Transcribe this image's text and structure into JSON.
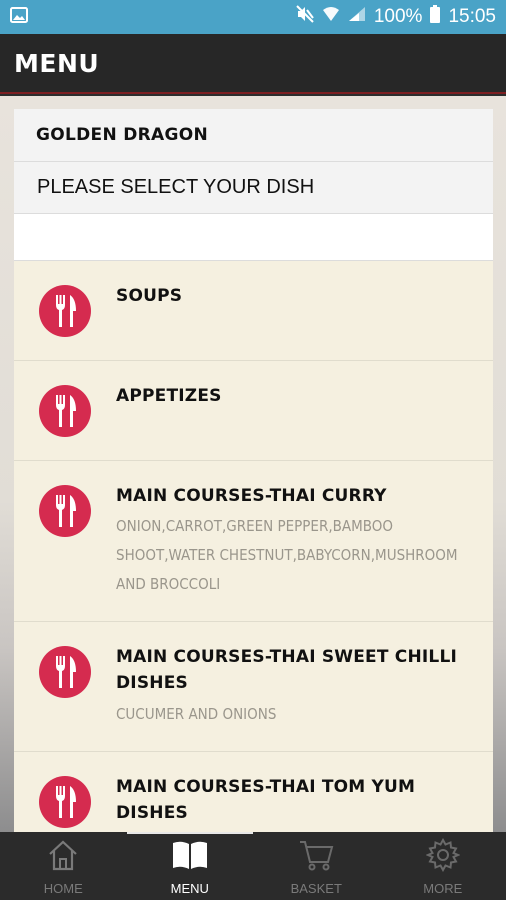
{
  "status_bar": {
    "battery": "100%",
    "time": "15:05",
    "icons": [
      "image-icon",
      "mute-icon",
      "wifi-icon",
      "signal-icon",
      "battery-icon"
    ]
  },
  "app_bar": {
    "title": "MENU"
  },
  "restaurant": {
    "name": "GOLDEN DRAGON"
  },
  "prompt": "PLEASE SELECT YOUR DISH",
  "categories": [
    {
      "title": "SOUPS",
      "description": ""
    },
    {
      "title": "APPETIZES",
      "description": ""
    },
    {
      "title": "MAIN COURSES-THAI CURRY",
      "description": "ONION,CARROT,GREEN PEPPER,BAMBOO SHOOT,WATER CHESTNUT,BABYCORN,MUSHROOM AND BROCCOLI"
    },
    {
      "title": "MAIN COURSES-THAI SWEET CHILLI DISHES",
      "description": "CUCUMER AND ONIONS"
    },
    {
      "title": "MAIN COURSES-THAI TOM YUM DISHES",
      "description": ""
    }
  ],
  "bottom_nav": {
    "active": "MENU",
    "tabs": [
      {
        "label": "HOME",
        "icon": "home-icon"
      },
      {
        "label": "MENU",
        "icon": "book-icon"
      },
      {
        "label": "BASKET",
        "icon": "cart-icon"
      },
      {
        "label": "MORE",
        "icon": "gear-icon"
      }
    ]
  },
  "colors": {
    "status_bar": "#4aa3c7",
    "app_bar": "#272727",
    "accent": "#d52b4f",
    "card": "#f5f0e0"
  }
}
